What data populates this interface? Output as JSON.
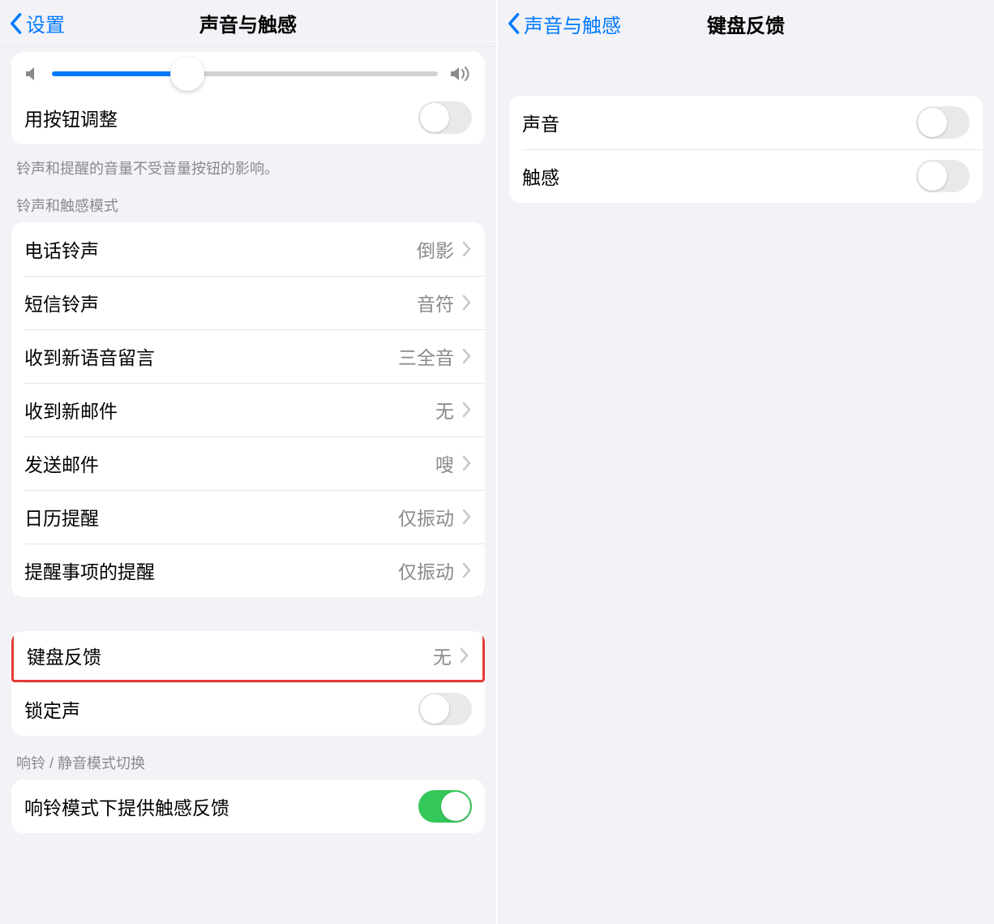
{
  "left": {
    "nav": {
      "back": "设置",
      "title": "声音与触感"
    },
    "slider": {
      "percent": 35
    },
    "adjust_with_buttons": {
      "label": "用按钮调整",
      "on": false
    },
    "adjust_footer": "铃声和提醒的音量不受音量按钮的影响。",
    "patterns_header": "铃声和触感模式",
    "rows": [
      {
        "label": "电话铃声",
        "value": "倒影"
      },
      {
        "label": "短信铃声",
        "value": "音符"
      },
      {
        "label": "收到新语音留言",
        "value": "三全音"
      },
      {
        "label": "收到新邮件",
        "value": "无"
      },
      {
        "label": "发送邮件",
        "value": "嗖"
      },
      {
        "label": "日历提醒",
        "value": "仅振动"
      },
      {
        "label": "提醒事项的提醒",
        "value": "仅振动"
      }
    ],
    "keyboard_feedback": {
      "label": "键盘反馈",
      "value": "无"
    },
    "lock_sound": {
      "label": "锁定声",
      "on": false
    },
    "ring_silent_header": "响铃 / 静音模式切换",
    "ring_haptic": {
      "label": "响铃模式下提供触感反馈",
      "on": true
    }
  },
  "right": {
    "nav": {
      "back": "声音与触感",
      "title": "键盘反馈"
    },
    "rows": [
      {
        "label": "声音",
        "on": false
      },
      {
        "label": "触感",
        "on": false
      }
    ]
  }
}
